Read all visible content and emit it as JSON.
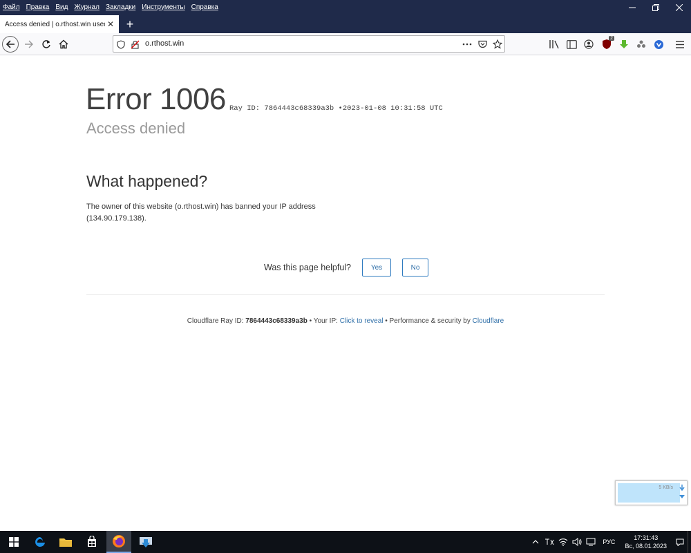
{
  "menu": [
    "Файл",
    "Правка",
    "Вид",
    "Журнал",
    "Закладки",
    "Инструменты",
    "Справка"
  ],
  "tab": {
    "title": "Access denied | o.rthost.win used C",
    "close": "✕"
  },
  "newtab": "+",
  "url": "o.rthost.win",
  "ublock_badge": "2",
  "page": {
    "error_title": "Error 1006",
    "ray_label": "Ray ID: 7864443c68339a3b",
    "ray_sep": "•",
    "ray_time": "2023-01-08 10:31:58 UTC",
    "subtitle": "Access denied",
    "what_happened": "What happened?",
    "explanation": "The owner of this website (o.rthost.win) has banned your IP address (134.90.179.138).",
    "helpful_label": "Was this page helpful?",
    "yes": "Yes",
    "no": "No",
    "footer": {
      "ray_prefix": "Cloudflare Ray ID: ",
      "ray_id": "7864443c68339a3b",
      "ip_prefix": " • Your IP: ",
      "ip_link": "Click to reveal",
      "perf": " • Performance & security by ",
      "cf_link": "Cloudflare"
    }
  },
  "net_widget": {
    "speed": "5 KB/s"
  },
  "taskbar": {
    "lang": "РУС",
    "time": "17:31:43",
    "date": "Вс, 08.01.2023"
  },
  "colors": {
    "titlebar": "#1f2a4a",
    "link": "#2f6fa8",
    "taskbar": "#0d1117"
  }
}
